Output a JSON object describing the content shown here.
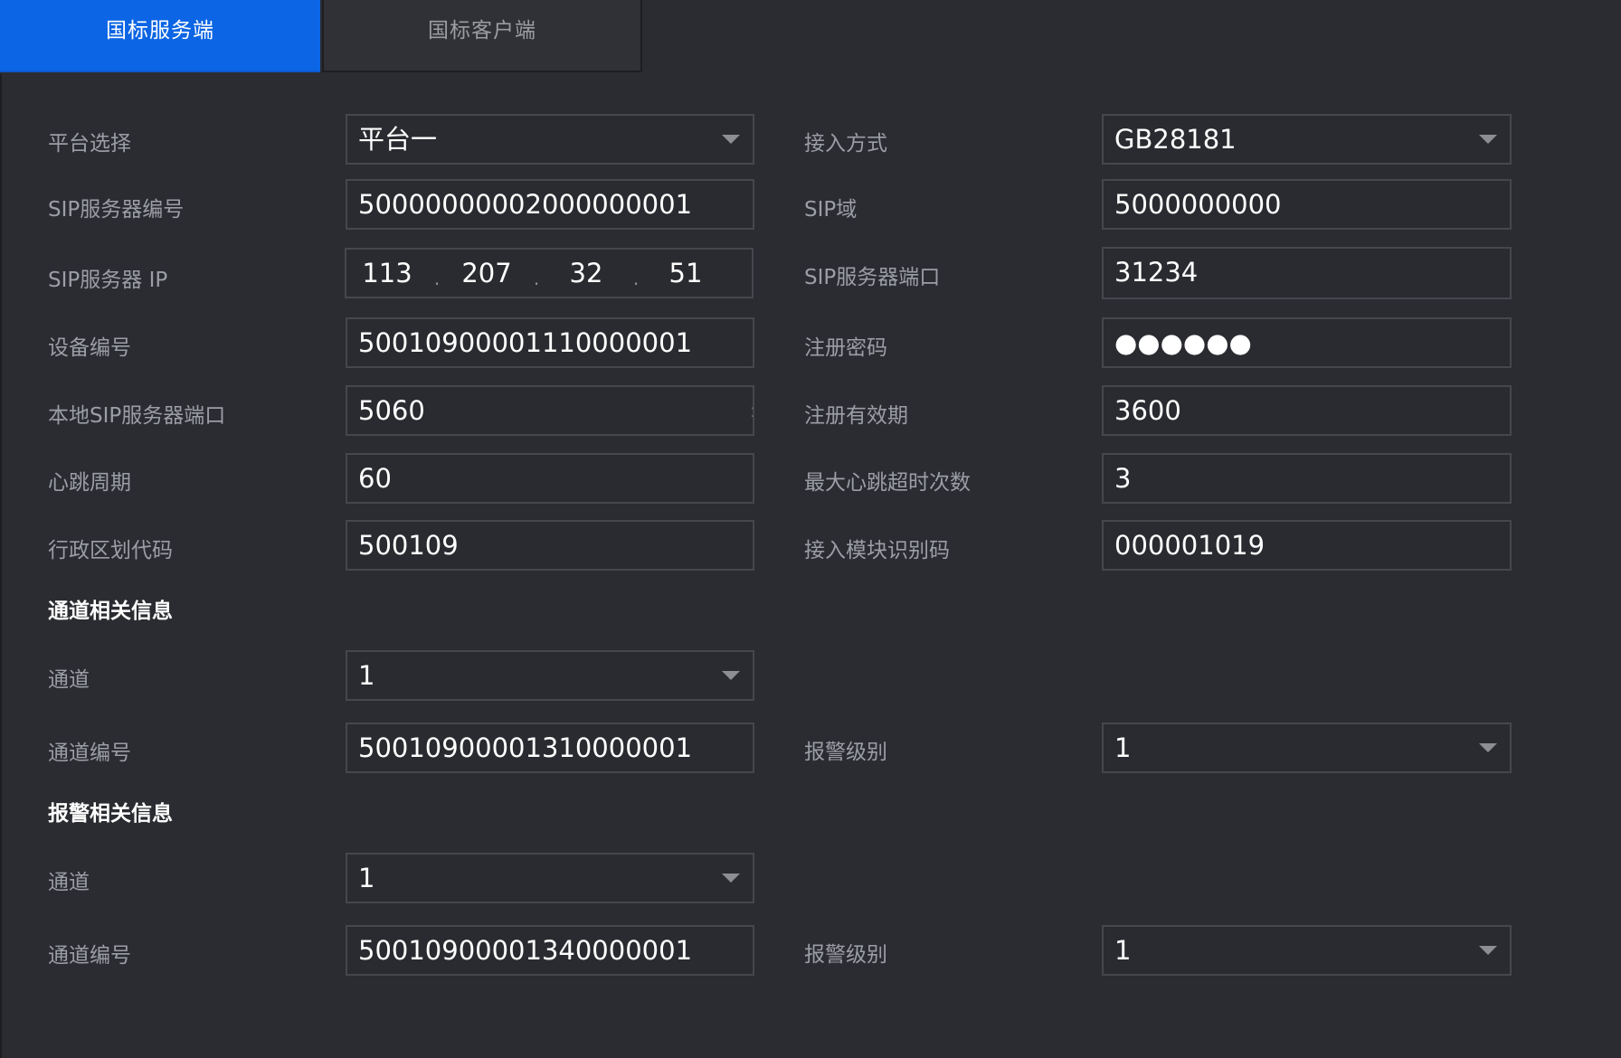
{
  "tabs": {
    "server": "国标服务端",
    "client": "国标客户端"
  },
  "labels": {
    "platform_select": "平台选择",
    "sip_server_id": "SIP服务器编号",
    "sip_server_ip": "SIP服务器 IP",
    "device_id": "设备编号",
    "local_sip_port": "本地SIP服务器端口",
    "heartbeat_period": "心跳周期",
    "region_code": "行政区划代码",
    "access_mode": "接入方式",
    "sip_domain": "SIP域",
    "sip_server_port": "SIP服务器端口",
    "register_password": "注册密码",
    "register_validity": "注册有效期",
    "max_heartbeat_timeouts": "最大心跳超时次数",
    "access_module_id": "接入模块识别码"
  },
  "values": {
    "platform_select": "平台一",
    "sip_server_id": "50000000002000000001",
    "sip_server_ip": [
      "113",
      "207",
      "32",
      "51"
    ],
    "device_id": "50010900001110000001",
    "local_sip_port": "5060",
    "heartbeat_period": "60",
    "region_code": "500109",
    "access_mode": "GB28181",
    "sip_domain": "5000000000",
    "sip_server_port": "31234",
    "register_password": "●●●●●●",
    "register_validity": "3600",
    "max_heartbeat_timeouts": "3",
    "access_module_id": "000001019"
  },
  "channel_section": {
    "title": "通道相关信息",
    "channel_label": "通道",
    "channel_value": "1",
    "channel_id_label": "通道编号",
    "channel_id_value": "50010900001310000001",
    "alarm_level_label": "报警级别",
    "alarm_level_value": "1"
  },
  "alarm_section": {
    "title": "报警相关信息",
    "channel_label": "通道",
    "channel_value": "1",
    "channel_id_label": "通道编号",
    "channel_id_value": "50010900001340000001",
    "alarm_level_label": "报警级别",
    "alarm_level_value": "1"
  },
  "colors": {
    "background": "#2b2c31",
    "active_tab": "#0b65e4",
    "label_text": "#9c9ea6",
    "field_border": "#46474d"
  }
}
